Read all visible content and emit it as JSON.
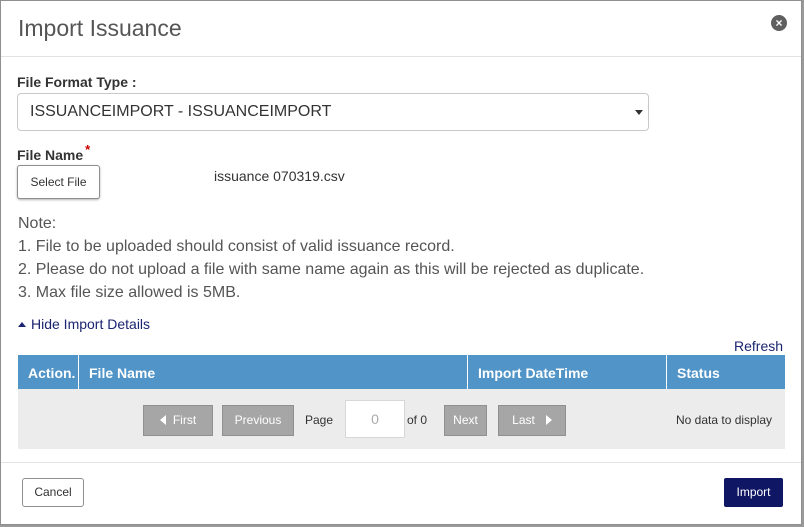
{
  "dialog": {
    "title": "Import Issuance",
    "close_icon": "close-icon"
  },
  "form": {
    "format_label": "File Format Type :",
    "format_value": "ISSUANCEIMPORT - ISSUANCEIMPORT",
    "file_label": "File Name",
    "required_mark": "*",
    "select_file_label": "Select File",
    "selected_file": "issuance 070319.csv"
  },
  "notes": {
    "heading": "Note:",
    "items": [
      "1. File to be uploaded should consist of valid issuance record.",
      "2. Please do not upload a file with same name again as this will be rejected as duplicate.",
      "3. Max file size allowed is 5MB."
    ]
  },
  "details": {
    "toggle_label": "Hide Import Details",
    "refresh_label": "Refresh"
  },
  "table": {
    "columns": [
      "Action.",
      "File Name",
      "Import DateTime",
      "Status"
    ]
  },
  "pager": {
    "first": "First",
    "previous": "Previous",
    "page_label": "Page",
    "page_value": "0",
    "of_label": "of 0",
    "next": "Next",
    "last": "Last",
    "empty_text": "No data to display"
  },
  "footer": {
    "cancel_label": "Cancel",
    "import_label": "Import"
  },
  "colors": {
    "header_blue": "#5194c8",
    "primary": "#0f1663",
    "link": "#1a2470"
  }
}
